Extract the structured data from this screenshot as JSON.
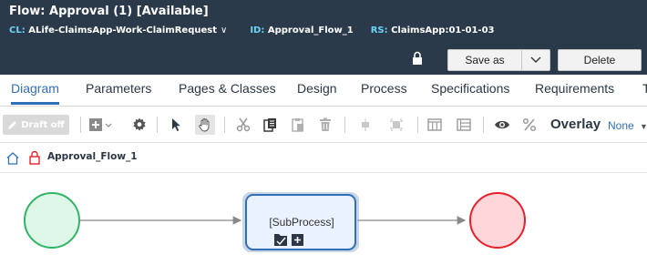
{
  "header": {
    "title": "Flow: Approval (1) [Available]",
    "cl_key": "CL:",
    "cl_value": "ALife-ClaimsApp-Work-ClaimRequest",
    "id_key": "ID:",
    "id_value": "Approval_Flow_1",
    "rs_key": "RS:",
    "rs_value": "ClaimsApp:01-01-03",
    "save_as_label": "Save as",
    "delete_label": "Delete"
  },
  "tabs": [
    "Diagram",
    "Parameters",
    "Pages & Classes",
    "Design",
    "Process",
    "Specifications",
    "Requirements",
    "T"
  ],
  "active_tab": "Diagram",
  "toolbar": {
    "draft_label": "Draft off",
    "overlay_label": "Overlay",
    "overlay_value": "None"
  },
  "breadcrumb": {
    "name": "Approval_Flow_1"
  },
  "diagram": {
    "subprocess_label": "[SubProcess]",
    "colors": {
      "start_fill": "#dff7e8",
      "start_stroke": "#2fb566",
      "end_fill": "#ffd6da",
      "end_stroke": "#e8202a",
      "shape_fill": "#eaf1ff",
      "shape_stroke": "#2f6fb7",
      "connector": "#888888"
    }
  },
  "colors": {
    "header_bg": "#2b3a4a",
    "accent": "#2f6fb7",
    "meta_key": "#6fd3f6"
  }
}
